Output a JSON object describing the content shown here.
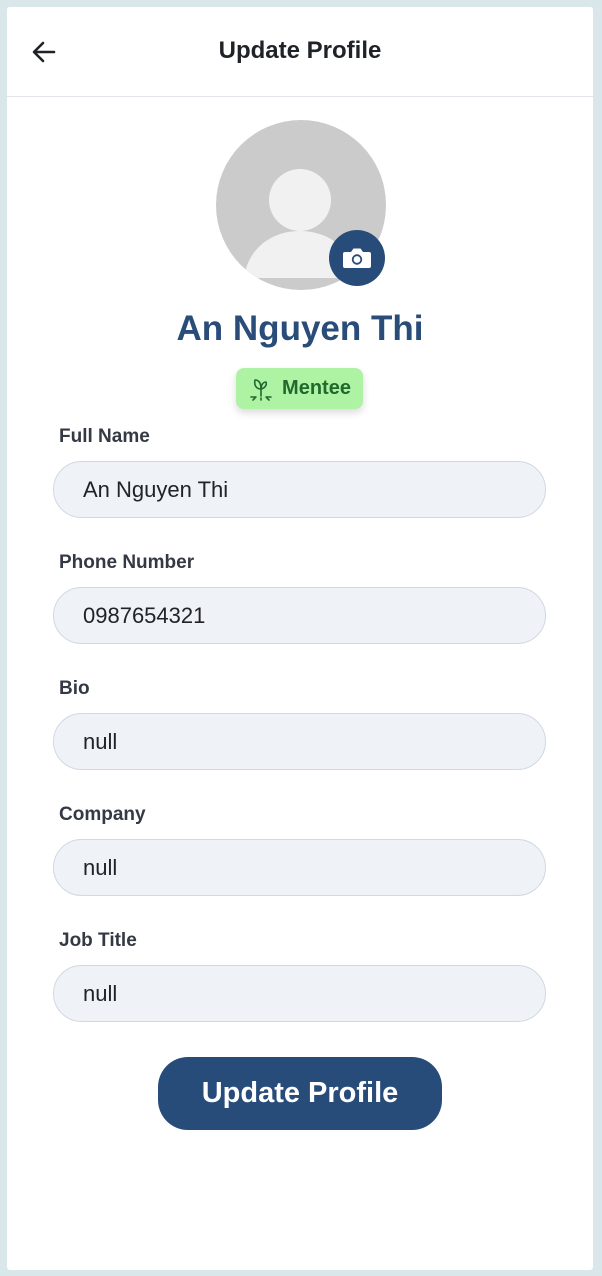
{
  "header": {
    "title": "Update Profile",
    "back_icon": "arrow-left-icon"
  },
  "profile": {
    "avatar_icon": "person-placeholder-icon",
    "camera_icon": "camera-icon",
    "name": "An Nguyen Thi",
    "role": {
      "label": "Mentee",
      "icon": "sprout-icon",
      "background": "#aef2a4",
      "text_color": "#1f6a2c"
    }
  },
  "form": {
    "fields": [
      {
        "label": "Full Name",
        "value": "An Nguyen Thi"
      },
      {
        "label": "Phone Number",
        "value": "0987654321"
      },
      {
        "label": "Bio",
        "value": "null"
      },
      {
        "label": "Company",
        "value": "null"
      },
      {
        "label": "Job Title",
        "value": "null"
      }
    ],
    "submit_label": "Update Profile"
  },
  "colors": {
    "primary": "#284c7a",
    "input_bg": "#eff2f7",
    "input_border": "#cfd8e3",
    "page_bg": "#d9e6ea"
  }
}
